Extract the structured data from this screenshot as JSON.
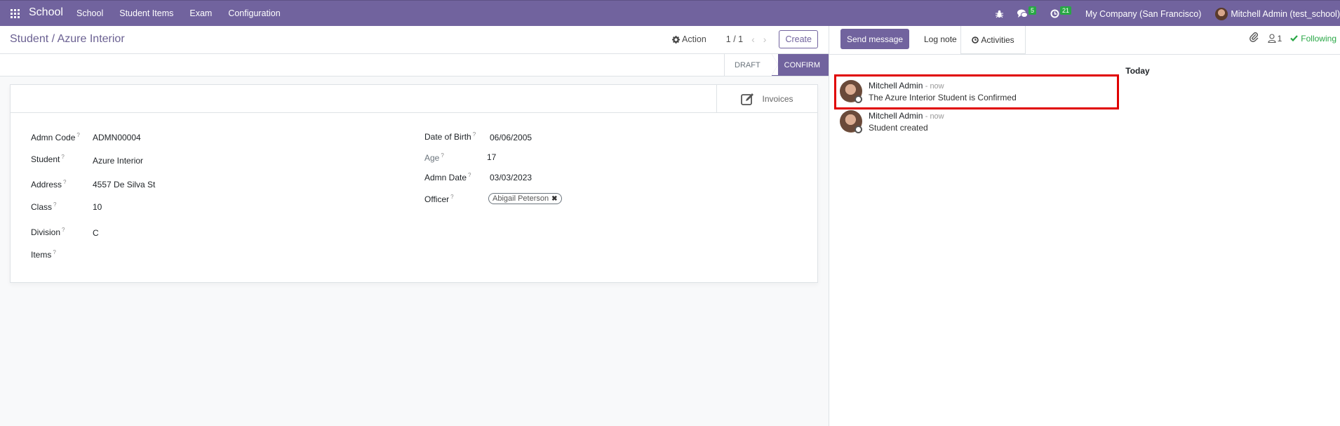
{
  "navbar": {
    "brand": "School",
    "menu": [
      "School",
      "Student Items",
      "Exam",
      "Configuration"
    ],
    "messages_badge": "5",
    "activities_badge": "21",
    "company": "My Company (San Francisco)",
    "user": "Mitchell Admin (test_school)"
  },
  "control_panel": {
    "breadcrumb": "Student / Azure Interior",
    "action_label": "Action",
    "pager": "1 / 1",
    "create_label": "Create"
  },
  "statusbar": {
    "stages": [
      "Draft",
      "Confirm"
    ],
    "active": "Confirm"
  },
  "sheet": {
    "invoices_label": "Invoices",
    "left_fields": [
      {
        "label": "Admn Code",
        "value": "ADMN00004"
      },
      {
        "label": "Student",
        "value": "Azure Interior"
      },
      {
        "label": "Address",
        "value": "4557 De Silva St"
      },
      {
        "label": "Class",
        "value": "10"
      },
      {
        "label": "Division",
        "value": "C"
      },
      {
        "label": "Items",
        "value": ""
      }
    ],
    "right_fields": [
      {
        "label": "Date of Birth",
        "value": "06/06/2005"
      },
      {
        "label": "Age",
        "value": "17"
      },
      {
        "label": "Admn Date",
        "value": "03/03/2023"
      },
      {
        "label": "Officer",
        "value": "Abigail Peterson"
      }
    ],
    "help_marker": "?"
  },
  "chatter": {
    "send_message_label": "Send message",
    "log_note_label": "Log note",
    "activities_label": "Activities",
    "followers_count": "1",
    "following_label": "Following",
    "date_separator": "Today",
    "messages": [
      {
        "author": "Mitchell Admin",
        "time": "- now",
        "body": "The Azure Interior Student is Confirmed",
        "highlighted": true
      },
      {
        "author": "Mitchell Admin",
        "time": "- now",
        "body": "Student created",
        "highlighted": false
      }
    ]
  },
  "colors": {
    "brand": "#71639e",
    "following": "#28a745",
    "highlight": "#e00000"
  }
}
